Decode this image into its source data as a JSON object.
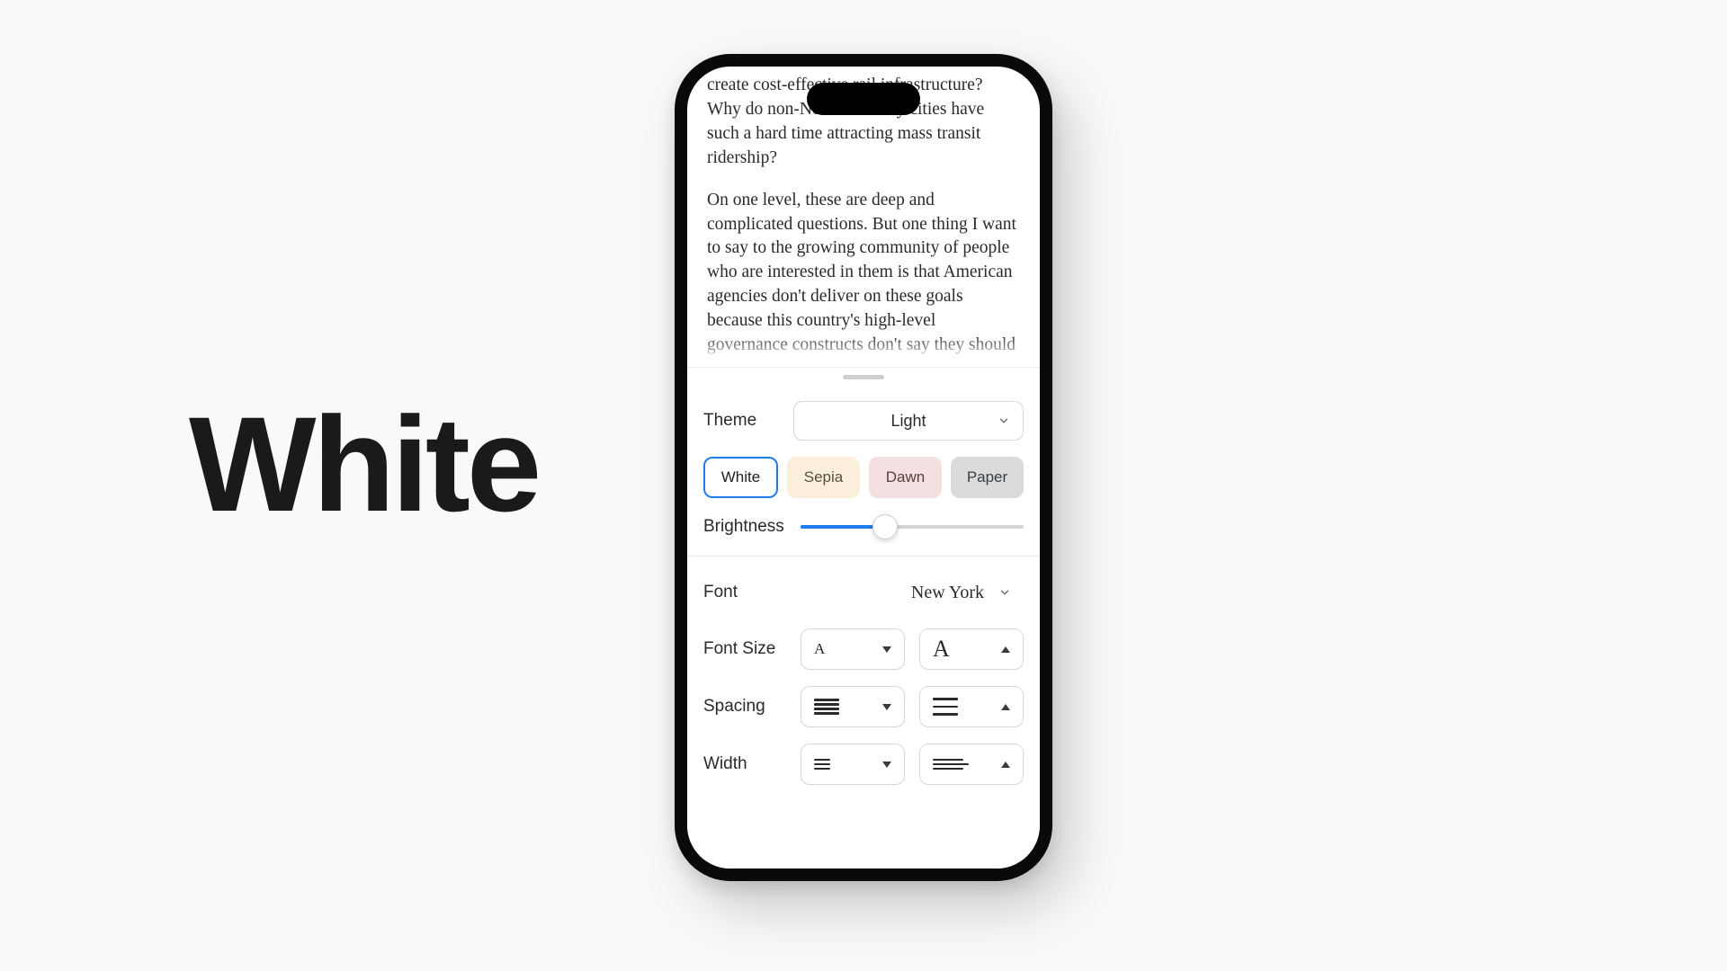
{
  "heading": "White",
  "article": {
    "p1": "create cost-effective rail infrastructure? Why do non-New York City cities have such a hard time attracting mass transit ridership?",
    "p2": "On one level, these are deep and complicated questions. But one thing I want to say to the growing community of people who are interested in them is that American agencies don't deliver on these goals because this country's high-level governance constructs don't say they should deliver on them. Of course you"
  },
  "settings": {
    "theme": {
      "label": "Theme",
      "value": "Light"
    },
    "swatches": {
      "white": "White",
      "sepia": "Sepia",
      "dawn": "Dawn",
      "paper": "Paper"
    },
    "brightness": {
      "label": "Brightness",
      "value": 0.38
    },
    "font": {
      "label": "Font",
      "value": "New York"
    },
    "fontSize": {
      "label": "Font Size",
      "smallGlyph": "A",
      "largeGlyph": "A"
    },
    "spacing": {
      "label": "Spacing"
    },
    "width": {
      "label": "Width"
    }
  }
}
